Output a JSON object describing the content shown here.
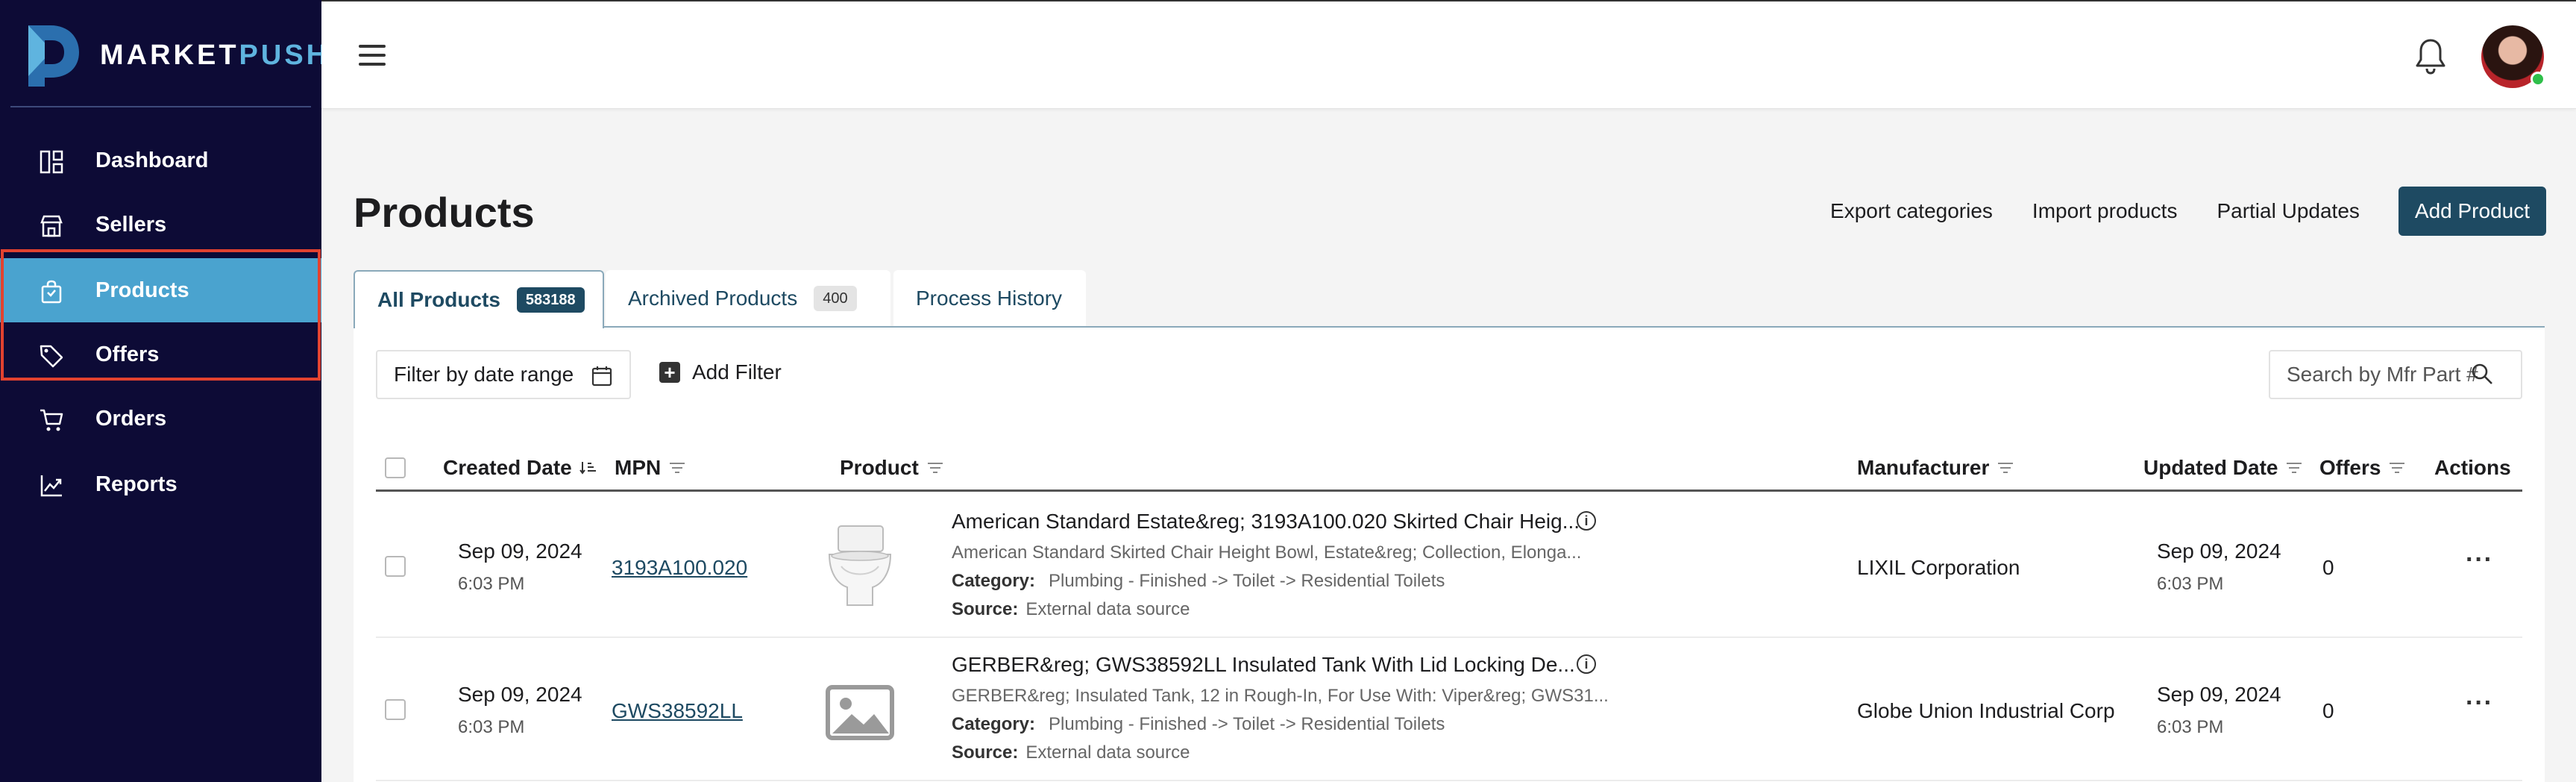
{
  "app": {
    "logo_text_a": "MARKET",
    "logo_text_b": "PUSH",
    "brand_color": "#0d0b36",
    "accent_color": "#4aa3cf",
    "primary_button_color": "#1e4a62",
    "highlight_color": "#e2422f"
  },
  "sidebar": {
    "items": [
      {
        "label": "Dashboard",
        "icon": "dashboard-icon"
      },
      {
        "label": "Sellers",
        "icon": "store-icon"
      },
      {
        "label": "Products",
        "icon": "bag-icon",
        "active": true
      },
      {
        "label": "Offers",
        "icon": "tag-icon"
      },
      {
        "label": "Orders",
        "icon": "cart-icon"
      },
      {
        "label": "Reports",
        "icon": "chart-icon"
      }
    ]
  },
  "topbar": {
    "icons": [
      "menu-icon",
      "bell-icon",
      "avatar"
    ]
  },
  "header": {
    "title": "Products",
    "actions": {
      "export": "Export categories",
      "import": "Import products",
      "partial": "Partial Updates",
      "add": "Add Product"
    }
  },
  "tabs": [
    {
      "label": "All Products",
      "count": "583188"
    },
    {
      "label": "Archived Products",
      "count": "400"
    },
    {
      "label": "Process History"
    }
  ],
  "filters": {
    "date_range": "Filter by date range",
    "add_filter": "Add Filter",
    "search_placeholder": "Search by Mfr Part #"
  },
  "table": {
    "columns": {
      "created": "Created Date",
      "mpn": "MPN",
      "product": "Product",
      "manufacturer": "Manufacturer",
      "updated": "Updated Date",
      "offers": "Offers",
      "actions": "Actions"
    },
    "rows": [
      {
        "created_date": "Sep 09, 2024",
        "created_time": "6:03 PM",
        "mpn": "3193A100.020",
        "title": "American Standard Estate&reg; 3193A100.020 Skirted Chair Heig...",
        "description": "American Standard Skirted Chair Height Bowl, Estate&reg; Collection, Elonga...",
        "category_label": "Category:",
        "category": "Plumbing - Finished -> Toilet -> Residential Toilets",
        "source_label": "Source:",
        "source": "External data source",
        "manufacturer": "LIXIL Corporation",
        "updated_date": "Sep 09, 2024",
        "updated_time": "6:03 PM",
        "offers": "0",
        "image": "toilet-image"
      },
      {
        "created_date": "Sep 09, 2024",
        "created_time": "6:03 PM",
        "mpn": "GWS38592LL",
        "title": "GERBER&reg; GWS38592LL Insulated Tank With Lid Locking De...",
        "description": "GERBER&reg; Insulated Tank, 12 in Rough-In, For Use With: Viper&reg; GWS31...",
        "category_label": "Category:",
        "category": "Plumbing - Finished -> Toilet -> Residential Toilets",
        "source_label": "Source:",
        "source": "External data source",
        "manufacturer": "Globe Union Industrial Corp",
        "updated_date": "Sep 09, 2024",
        "updated_time": "6:03 PM",
        "offers": "0",
        "image": "placeholder-image"
      }
    ]
  }
}
